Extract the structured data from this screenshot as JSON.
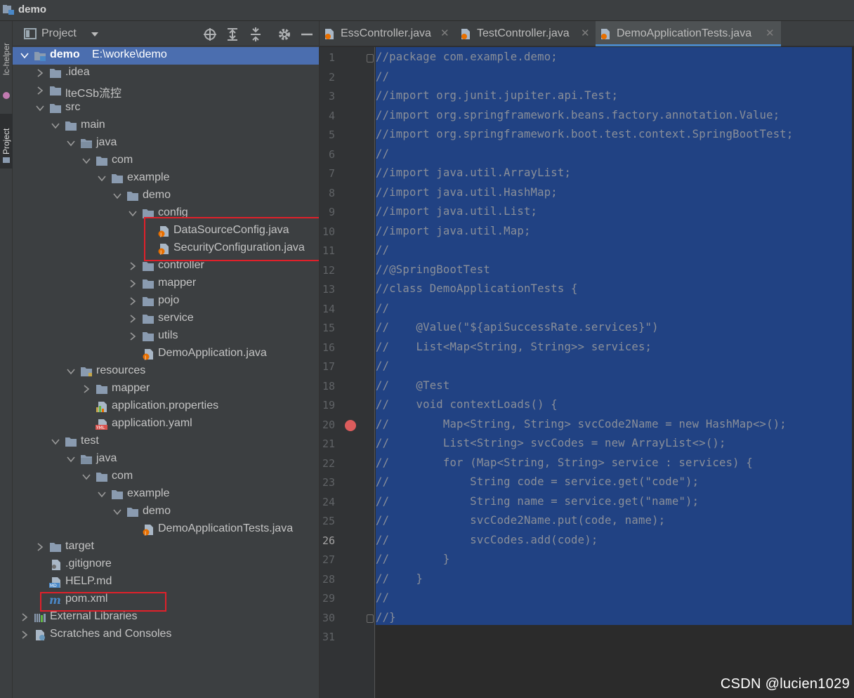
{
  "window": {
    "title": "demo"
  },
  "stripe": {
    "tab1": "lc-helper",
    "tab2": "Project"
  },
  "panel": {
    "title": "Project"
  },
  "tree": [
    {
      "label": "demo",
      "path": "E:\\worke\\demo",
      "type": "module",
      "expanded": true,
      "selected": true
    },
    {
      "label": ".idea",
      "type": "folder",
      "expanded": false
    },
    {
      "label": "lteCSb流控",
      "type": "folder",
      "expanded": false
    },
    {
      "label": "src",
      "type": "folder",
      "expanded": true
    },
    {
      "label": "main",
      "type": "folder",
      "expanded": true
    },
    {
      "label": "java",
      "type": "folder-src",
      "expanded": true
    },
    {
      "label": "com",
      "type": "folder",
      "expanded": true
    },
    {
      "label": "example",
      "type": "folder",
      "expanded": true
    },
    {
      "label": "demo",
      "type": "folder",
      "expanded": true
    },
    {
      "label": "config",
      "type": "folder",
      "expanded": true
    },
    {
      "label": "DataSourceConfig.java",
      "type": "java"
    },
    {
      "label": "SecurityConfiguration.java",
      "type": "java"
    },
    {
      "label": "controller",
      "type": "folder",
      "expanded": false
    },
    {
      "label": "mapper",
      "type": "folder",
      "expanded": false
    },
    {
      "label": "pojo",
      "type": "folder",
      "expanded": false
    },
    {
      "label": "service",
      "type": "folder",
      "expanded": false
    },
    {
      "label": "utils",
      "type": "folder",
      "expanded": false
    },
    {
      "label": "DemoApplication.java",
      "type": "java"
    },
    {
      "label": "resources",
      "type": "folder-res",
      "expanded": true
    },
    {
      "label": "mapper",
      "type": "folder",
      "expanded": false
    },
    {
      "label": "application.properties",
      "type": "properties"
    },
    {
      "label": "application.yaml",
      "type": "yaml"
    },
    {
      "label": "test",
      "type": "folder",
      "expanded": true
    },
    {
      "label": "java",
      "type": "folder-test",
      "expanded": true
    },
    {
      "label": "com",
      "type": "folder",
      "expanded": true
    },
    {
      "label": "example",
      "type": "folder",
      "expanded": true
    },
    {
      "label": "demo",
      "type": "folder",
      "expanded": true
    },
    {
      "label": "DemoApplicationTests.java",
      "type": "java"
    },
    {
      "label": "target",
      "type": "folder",
      "expanded": false
    },
    {
      "label": ".gitignore",
      "type": "gitignore"
    },
    {
      "label": "HELP.md",
      "type": "md"
    },
    {
      "label": "pom.xml",
      "type": "maven"
    },
    {
      "label": "External Libraries",
      "type": "libraries",
      "expanded": false
    },
    {
      "label": "Scratches and Consoles",
      "type": "scratches",
      "expanded": false
    }
  ],
  "tabs": [
    {
      "label": "EssController.java",
      "active": false
    },
    {
      "label": "TestController.java",
      "active": false
    },
    {
      "label": "DemoApplicationTests.java",
      "active": true
    }
  ],
  "editor": {
    "current_line": 26,
    "breakpoint_line": 20,
    "lines": [
      "//package com.example.demo;",
      "//",
      "//import org.junit.jupiter.api.Test;",
      "//import org.springframework.beans.factory.annotation.Value;",
      "//import org.springframework.boot.test.context.SpringBootTest;",
      "//",
      "//import java.util.ArrayList;",
      "//import java.util.HashMap;",
      "//import java.util.List;",
      "//import java.util.Map;",
      "//",
      "//@SpringBootTest",
      "//class DemoApplicationTests {",
      "//",
      "//    @Value(\"${apiSuccessRate.services}\")",
      "//    List<Map<String, String>> services;",
      "//",
      "//    @Test",
      "//    void contextLoads() {",
      "//        Map<String, String> svcCode2Name = new HashMap<>();",
      "//        List<String> svcCodes = new ArrayList<>();",
      "//        for (Map<String, String> service : services) {",
      "//            String code = service.get(\"code\");",
      "//            String name = service.get(\"name\");",
      "//            svcCode2Name.put(code, name);",
      "//            svcCodes.add(code);",
      "//        }",
      "//    }",
      "//",
      "//}",
      ""
    ]
  },
  "watermark": "CSDN @lucien1029",
  "colors": {
    "selection": "#214283",
    "tree_selected": "#4b6eaf",
    "highlight_box": "#e0202a",
    "breakpoint": "#db5c5c"
  }
}
